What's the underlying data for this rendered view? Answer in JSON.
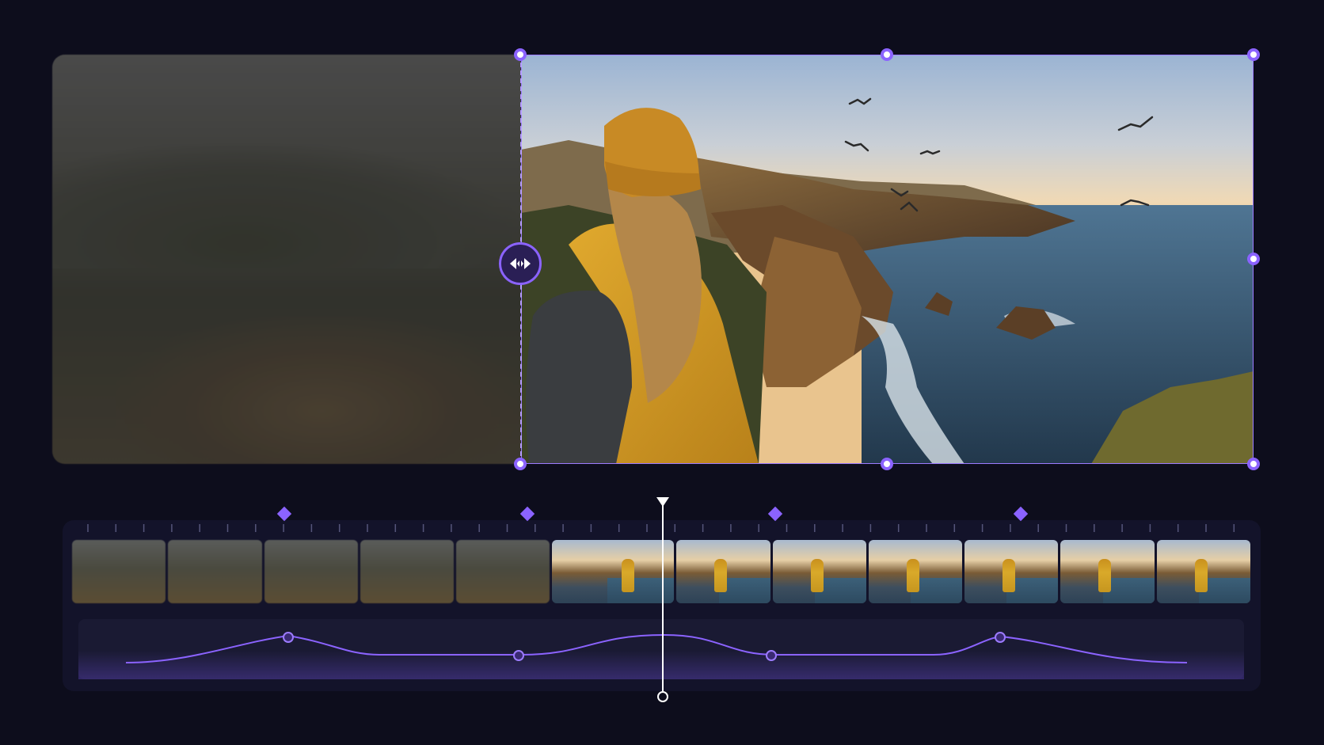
{
  "app": {
    "accent_color": "#8b63ff",
    "background_color": "#0d0d1c"
  },
  "preview": {
    "before_label": "",
    "after_label": "",
    "split_handle_icon": "split-arrows-icon",
    "crop_handles": [
      "top-left",
      "top-center",
      "top-right",
      "middle-right",
      "bottom-left",
      "bottom-center",
      "bottom-right"
    ]
  },
  "timeline": {
    "keyframes": [
      {
        "id": "kf-1",
        "position_pct": 18.5
      },
      {
        "id": "kf-2",
        "position_pct": 38.8
      },
      {
        "id": "kf-3",
        "position_pct": 59.5
      },
      {
        "id": "kf-4",
        "position_pct": 80.0
      }
    ],
    "playhead_position_pct": 49.7,
    "frames": [
      {
        "style": "blur"
      },
      {
        "style": "blur"
      },
      {
        "style": "blur"
      },
      {
        "style": "blur"
      },
      {
        "style": "blur"
      },
      {
        "style": "sharp"
      },
      {
        "style": "sharp"
      },
      {
        "style": "sharp"
      },
      {
        "style": "sharp"
      },
      {
        "style": "sharp"
      },
      {
        "style": "sharp"
      },
      {
        "style": "sharp"
      }
    ],
    "curve_color": "#8b63ff"
  }
}
